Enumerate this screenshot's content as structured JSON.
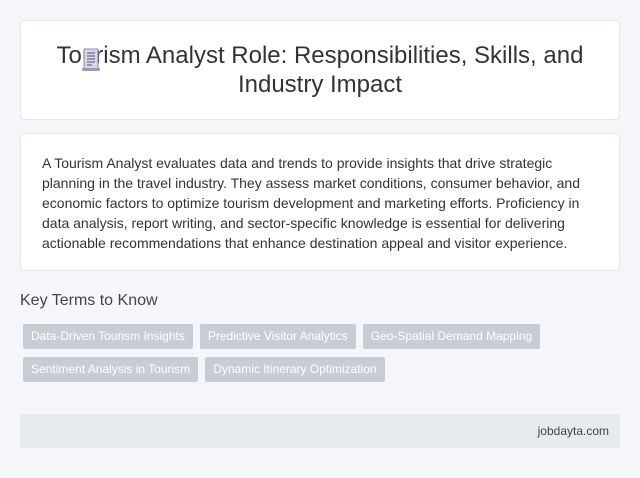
{
  "header": {
    "icon": "document-icon",
    "title": "Tourism Analyst Role: Responsibilities, Skills, and Industry Impact"
  },
  "description": "A Tourism Analyst evaluates data and trends to provide insights that drive strategic planning in the travel industry. They assess market conditions, consumer behavior, and economic factors to optimize tourism development and marketing efforts. Proficiency in data analysis, report writing, and sector-specific knowledge is essential for delivering actionable recommendations that enhance destination appeal and visitor experience.",
  "key_terms": {
    "heading": "Key Terms to Know",
    "items": [
      "Data-Driven Tourism Insights",
      "Predictive Visitor Analytics",
      "Geo-Spatial Demand Mapping",
      "Sentiment Analysis in Tourism",
      "Dynamic Itinerary Optimization"
    ]
  },
  "footer": {
    "site": "jobdayta.com"
  },
  "colors": {
    "background": "#f4f6f9",
    "tag_background": "#c8ccd5",
    "footer_background": "#e6ebee"
  }
}
